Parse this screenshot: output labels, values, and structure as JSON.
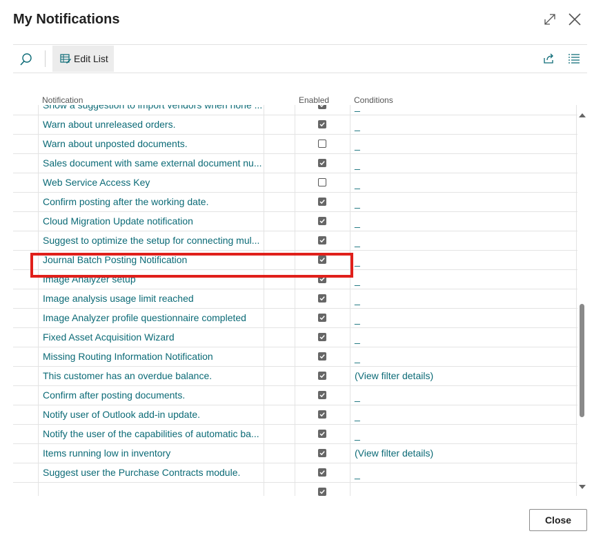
{
  "dialog": {
    "title": "My Notifications",
    "expand_icon": "expand-icon",
    "close_icon": "close-icon"
  },
  "actionbar": {
    "search_icon": "search-icon",
    "edit_list_label": "Edit List",
    "share_icon": "share-icon",
    "list_view_icon": "list-view-icon"
  },
  "table": {
    "columns": [
      "Notification",
      "Enabled",
      "Conditions"
    ],
    "rows": [
      {
        "notification": "Show a suggestion to import vendors when none ...",
        "enabled": true,
        "conditions": "_"
      },
      {
        "notification": "Warn about unreleased orders.",
        "enabled": true,
        "conditions": "_"
      },
      {
        "notification": "Warn about unposted documents.",
        "enabled": false,
        "conditions": "_"
      },
      {
        "notification": "Sales document with same external document nu...",
        "enabled": true,
        "conditions": "_"
      },
      {
        "notification": "Web Service Access Key",
        "enabled": false,
        "conditions": "_"
      },
      {
        "notification": "Confirm posting after the working date.",
        "enabled": true,
        "conditions": "_"
      },
      {
        "notification": "Cloud Migration Update notification",
        "enabled": true,
        "conditions": "_"
      },
      {
        "notification": "Suggest to optimize the setup for connecting mul...",
        "enabled": true,
        "conditions": "_"
      },
      {
        "notification": "Journal Batch Posting Notification",
        "enabled": true,
        "conditions": "_"
      },
      {
        "notification": "Image Analyzer setup",
        "enabled": true,
        "conditions": "_"
      },
      {
        "notification": "Image analysis usage limit reached",
        "enabled": true,
        "conditions": "_"
      },
      {
        "notification": "Image Analyzer profile questionnaire completed",
        "enabled": true,
        "conditions": "_"
      },
      {
        "notification": "Fixed Asset Acquisition Wizard",
        "enabled": true,
        "conditions": "_"
      },
      {
        "notification": "Missing Routing Information Notification",
        "enabled": true,
        "conditions": "_"
      },
      {
        "notification": "This customer has an overdue balance.",
        "enabled": true,
        "conditions": "(View filter details)"
      },
      {
        "notification": "Confirm after posting documents.",
        "enabled": true,
        "conditions": "_"
      },
      {
        "notification": "Notify user of Outlook add-in update.",
        "enabled": true,
        "conditions": "_"
      },
      {
        "notification": "Notify the user of the capabilities of automatic ba...",
        "enabled": true,
        "conditions": "_"
      },
      {
        "notification": "Items running low in inventory",
        "enabled": true,
        "conditions": "(View filter details)"
      },
      {
        "notification": "Suggest user the Purchase Contracts module.",
        "enabled": true,
        "conditions": "_"
      },
      {
        "notification": "",
        "enabled": true,
        "conditions": ""
      }
    ],
    "highlighted_row": "Journal Batch Posting Notification"
  },
  "footer": {
    "close_label": "Close"
  },
  "colors": {
    "link": "#0b6a76",
    "highlight": "#e0201b"
  }
}
